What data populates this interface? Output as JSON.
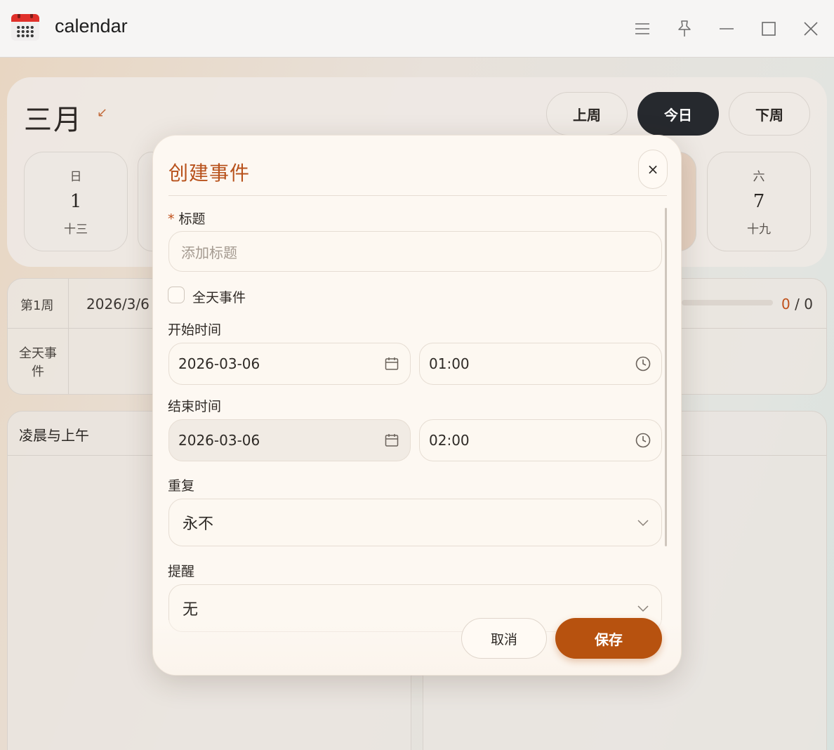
{
  "window": {
    "title": "calendar"
  },
  "header": {
    "month": "三月",
    "nav": {
      "prev": "上周",
      "today": "今日",
      "next": "下周"
    }
  },
  "days": [
    {
      "weekday": "日",
      "date": "1",
      "lunar": "十三"
    },
    {
      "weekday": "六",
      "date": "7",
      "lunar": "十九"
    }
  ],
  "week_table": {
    "week_label": "第1周",
    "date": "2026/3/6",
    "allday_label": "全天事件",
    "progress": {
      "done": "0",
      "separator": "/",
      "total": "0"
    }
  },
  "schedule": {
    "morning_title": "凌晨与上午"
  },
  "modal": {
    "title": "创建事件",
    "close_symbol": "×",
    "title_field": {
      "label": "标题",
      "required_mark": "*",
      "placeholder": "添加标题",
      "value": ""
    },
    "all_day": {
      "label": "全天事件",
      "checked": false
    },
    "start": {
      "label": "开始时间",
      "date": "2026-03-06",
      "time": "01:00"
    },
    "end": {
      "label": "结束时间",
      "date": "2026-03-06",
      "time": "02:00"
    },
    "repeat": {
      "label": "重复",
      "value": "永不"
    },
    "reminder": {
      "label": "提醒",
      "value": "无"
    },
    "buttons": {
      "cancel": "取消",
      "save": "保存"
    }
  },
  "colors": {
    "accent": "#b7520f",
    "dark_button": "#26292e",
    "title_accent": "#b8521c"
  }
}
